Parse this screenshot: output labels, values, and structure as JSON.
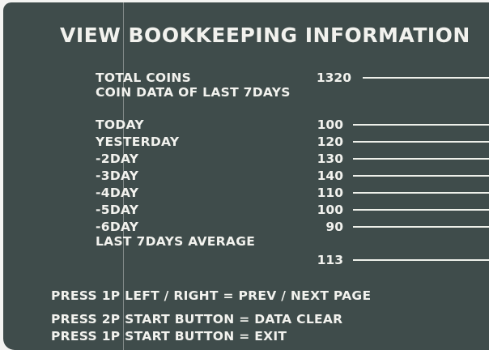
{
  "title": "VIEW BOOKKEEPING INFORMATION",
  "total_coins": {
    "label": "TOTAL COINS",
    "value": "1320"
  },
  "coin_data_heading": "COIN DATA OF LAST 7DAYS",
  "days": [
    {
      "label": "TODAY",
      "value": "100"
    },
    {
      "label": "YESTERDAY",
      "value": "120"
    },
    {
      "label": "-2DAY",
      "value": "130"
    },
    {
      "label": "-3DAY",
      "value": "140"
    },
    {
      "label": "-4DAY",
      "value": "110"
    },
    {
      "label": "-5DAY",
      "value": "100"
    },
    {
      "label": "-6DAY",
      "value": "90"
    }
  ],
  "average": {
    "label": "LAST 7DAYS AVERAGE",
    "value": "113"
  },
  "instructions": [
    "PRESS 1P LEFT / RIGHT = PREV / NEXT PAGE",
    "PRESS 2P START BUTTON = DATA CLEAR",
    "PRESS 1P START BUTTON = EXIT"
  ],
  "colors": {
    "screen_bg": "#3f4c4b",
    "text": "#f2f2ee"
  }
}
